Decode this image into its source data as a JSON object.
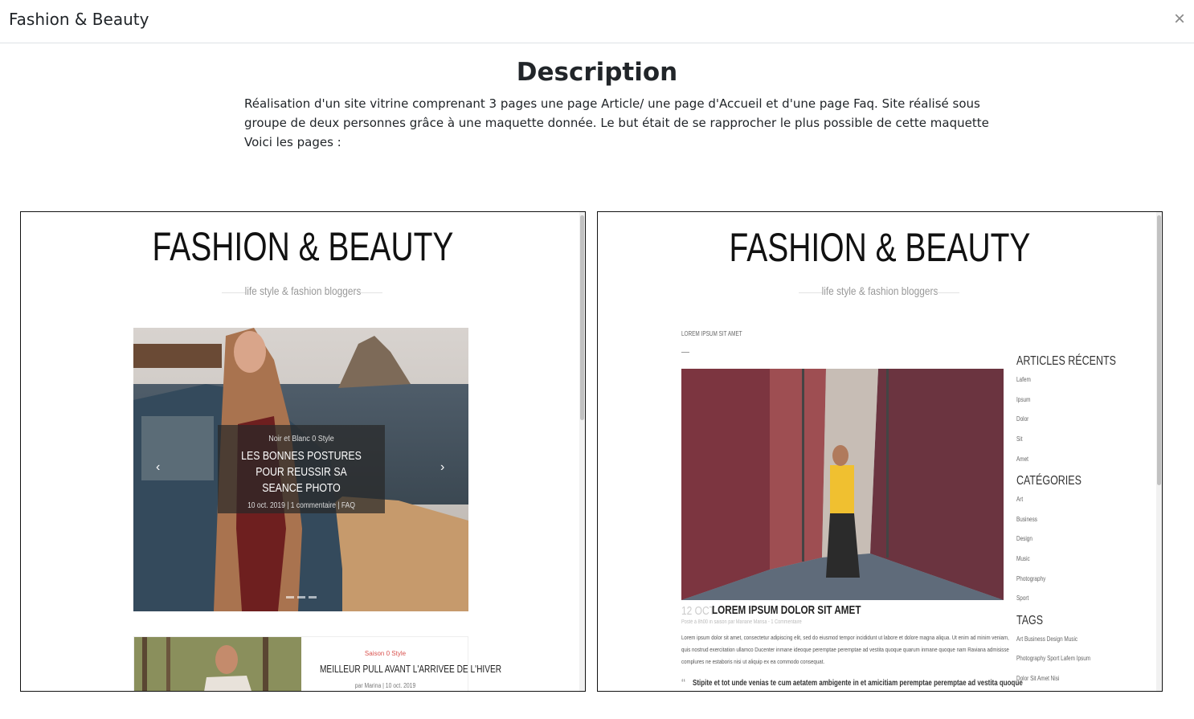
{
  "modal": {
    "title": "Fashion & Beauty",
    "close_label": "×"
  },
  "description": {
    "heading": "Description",
    "lines": [
      "Réalisation d'un site vitrine comprenant 3 pages une page Article/ une page d'Accueil et d'une page Faq. Site réalisé sous",
      "groupe de deux personnes grâce à une maquette donnée. Le but était de se rapprocher le plus possible de cette maquette",
      "Voici les pages :"
    ]
  },
  "home_page": {
    "brand": "FASHION & BEAUTY",
    "tagline": "life style & fashion bloggers",
    "slide": {
      "category": "Noir et Blanc 0 Style",
      "title_line1": "LES BONNES POSTURES POUR REUSSIR SA",
      "title_line2": "SEANCE PHOTO",
      "meta": "10 oct. 2019 | 1 commentaire | FAQ",
      "prev": "‹",
      "next": "›"
    },
    "card": {
      "category": "Saison 0 Style",
      "title": "MEILLEUR PULL AVANT L'ARRIVEE DE L'HIVER",
      "meta": "par Marina | 10 oct. 2019"
    }
  },
  "article_page": {
    "brand": "FASHION & BEAUTY",
    "tagline": "life style & fashion bloggers",
    "breadcrumb": "LOREM IPSUM SIT AMET",
    "post": {
      "date": "12 OCT",
      "title": "LOREM IPSUM DOLOR SIT AMET",
      "meta": "Posté à 8h00 in saison par Mariane Marisa - 1 Commentaire",
      "body": [
        "Lorem ipsum dolor sit amet, consectetur adipiscing elit, sed do eiusmod tempor incididunt ut labore et dolore magna aliqua. Ut enim ad minim veniam,",
        "quis nostrud exercitation ullamco Ducenter inmane ideoque peremptae peremptae ad vestita quoque quarum inmane quoque nam Raviana admisisse",
        "complures ne estaboris nisi ut aliquip ex ea commodo consequat."
      ],
      "quote": "Stipite et tot unde venias te cum aetatem ambigente in et amicitiam peremptae peremptae ad vestita quoque"
    },
    "sidebar": {
      "recent_heading": "ARTICLES RÉCENTS",
      "recent": [
        "Lafem",
        "Ipsum",
        "Dolor",
        "Sit",
        "Amet"
      ],
      "categories_heading": "CATÉGORIES",
      "categories": [
        "Art",
        "Business",
        "Design",
        "Music",
        "Photography",
        "Sport"
      ],
      "tags_heading": "TAGS",
      "tags": [
        "Art Business Design Music",
        "Photography Sport Lafem Ipsum",
        "Dolor Sit Amet Nisi"
      ]
    }
  },
  "colors": {
    "header_border": "#dee2e6",
    "text": "#212529",
    "card_category": "#d9534f"
  }
}
